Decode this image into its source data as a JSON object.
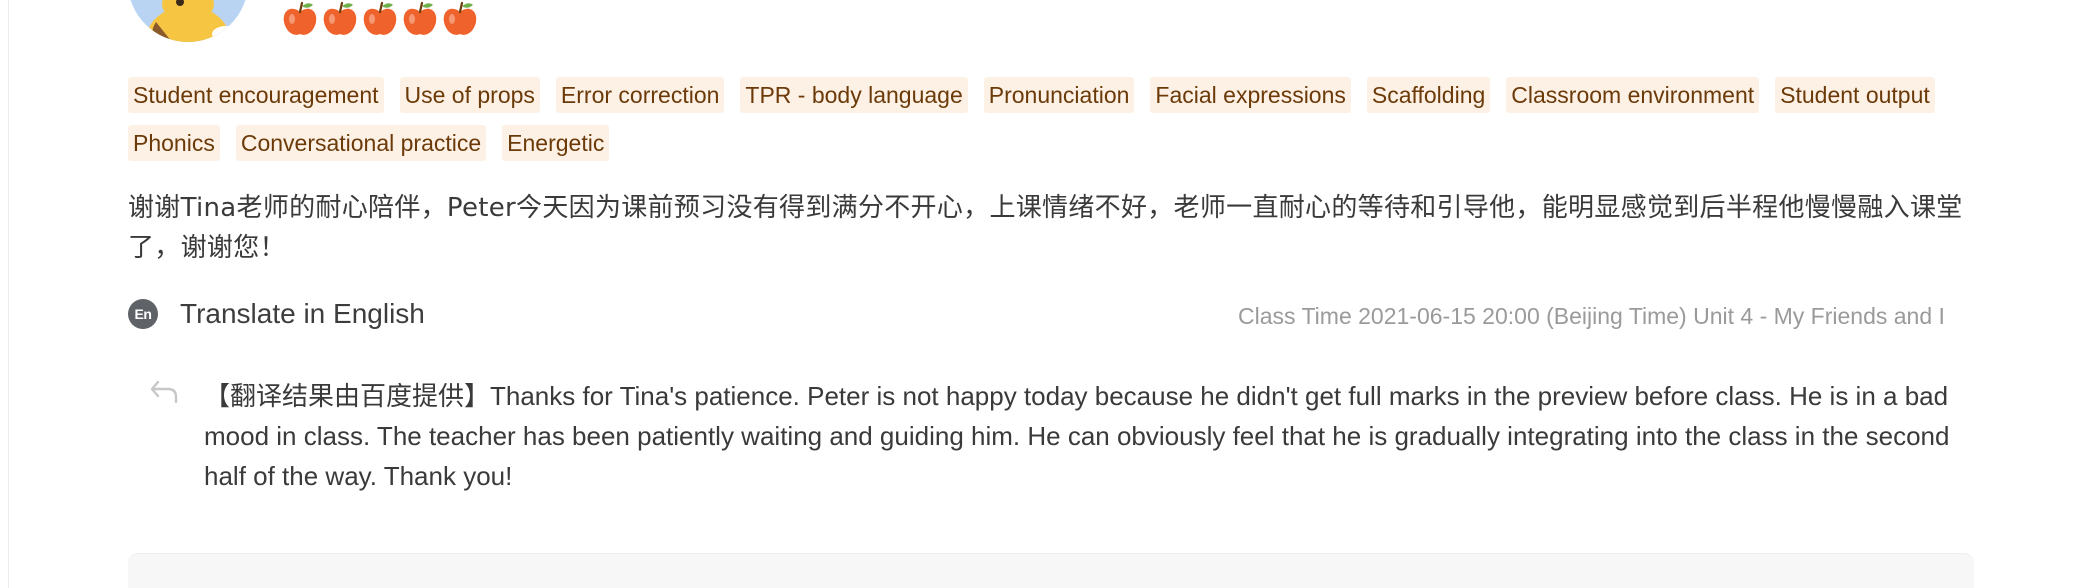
{
  "rating": {
    "count": 5,
    "max": 5,
    "color": "#f0622b",
    "icon": "apple-icon"
  },
  "tags": [
    "Student encouragement",
    "Use of props",
    "Error correction",
    "TPR - body language",
    "Pronunciation",
    "Facial expressions",
    "Scaffolding",
    "Classroom environment",
    "Student output",
    "Phonics",
    "Conversational practice",
    "Energetic"
  ],
  "comment": {
    "text": "谢谢Tina老师的耐心陪伴，Peter今天因为课前预习没有得到满分不开心，上课情绪不好，老师一直耐心的等待和引导他，能明显感觉到后半程他慢慢融入课堂了，谢谢您！"
  },
  "translate": {
    "icon_label": "En",
    "label": "Translate in English"
  },
  "class_info": {
    "text": "Class Time 2021-06-15 20:00 (Beijing Time) Unit 4 - My Friends and I"
  },
  "translation": {
    "text": "【翻译结果由百度提供】Thanks for Tina's patience. Peter is not happy today because he didn't get full marks in the preview before class. He is in a bad mood in class. The teacher has been patiently waiting and guiding him. He can obviously feel that he is gradually integrating into the class in the second half of the way. Thank you!"
  },
  "colors": {
    "tag_bg": "#fdf1e6",
    "tag_text": "#6b3a08",
    "apple": "#f0622b",
    "muted_text": "#9a9a9a"
  }
}
